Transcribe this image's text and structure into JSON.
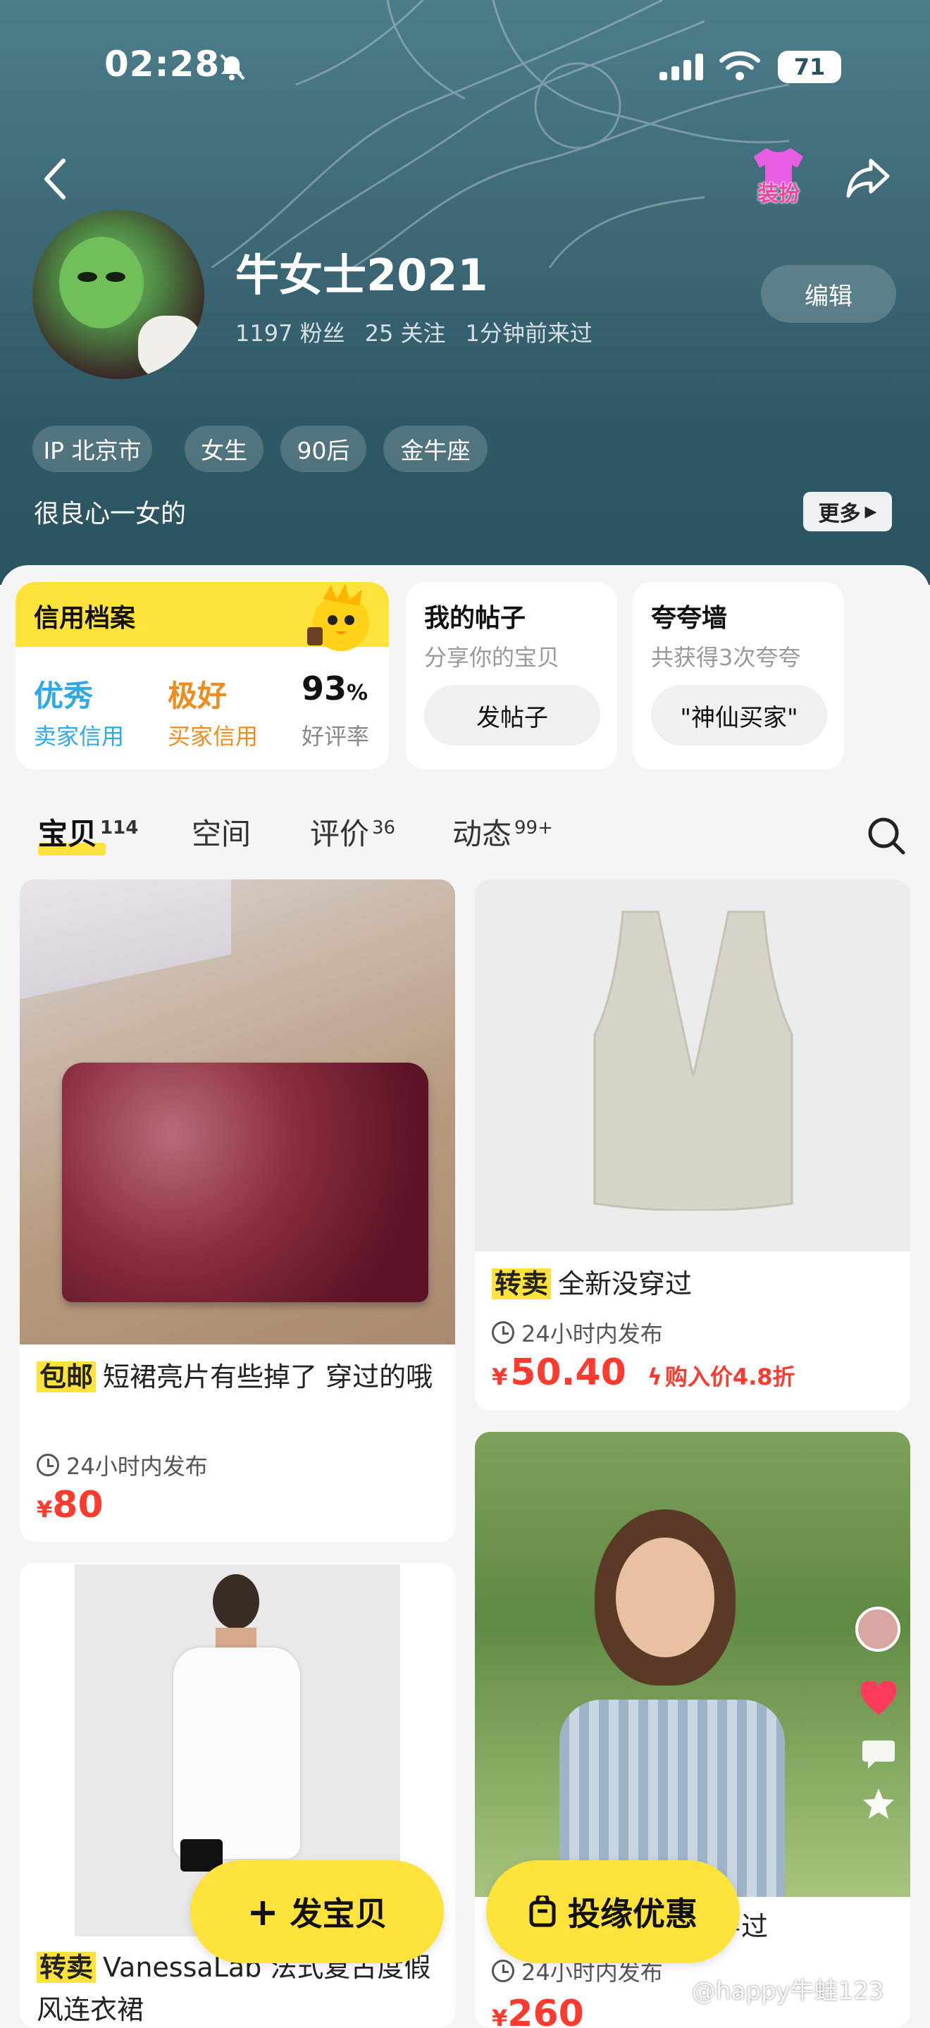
{
  "status_bar": {
    "time": "02:28",
    "battery": "71"
  },
  "profile": {
    "name": "牛女士2021",
    "stats": {
      "fans": "1197 粉丝",
      "following": "25 关注",
      "last_seen": "1分钟前来过"
    },
    "edit_label": "编辑",
    "dress_up_label": "装扮",
    "tags": [
      "IP 北京市",
      "女生",
      "90后",
      "金牛座"
    ],
    "bio": "很良心一女的",
    "more_label": "更多"
  },
  "credit": {
    "title": "信用档案",
    "seller": {
      "value": "优秀",
      "label": "卖家信用"
    },
    "buyer": {
      "value": "极好",
      "label": "买家信用"
    },
    "rating": {
      "value": "93",
      "unit": "%",
      "label": "好评率"
    }
  },
  "posts": {
    "title": "我的帖子",
    "subtitle": "分享你的宝贝",
    "button": "发帖子"
  },
  "praise": {
    "title": "夸夸墙",
    "subtitle": "共获得3次夸夸",
    "button": "\"神仙买家\""
  },
  "tabs": [
    {
      "label": "宝贝",
      "count": "114"
    },
    {
      "label": "空间",
      "count": ""
    },
    {
      "label": "评价",
      "count": "36"
    },
    {
      "label": "动态",
      "count": "99+"
    }
  ],
  "products": [
    {
      "badge": "包邮",
      "title": "短裙亮片有些掉了 穿过的哦",
      "time": "24小时内发布",
      "currency": "¥",
      "price": "80"
    },
    {
      "badge": "转卖",
      "title": "全新没穿过",
      "time": "24小时内发布",
      "currency": "¥",
      "price": "50.40",
      "discount": "购入价4.8折"
    },
    {
      "badge": "转卖",
      "title": "VanessaLab 法式复古度假风连衣裙",
      "time": "",
      "currency": "",
      "price": ""
    },
    {
      "badge": "",
      "title": "穿过",
      "time": "24小时内发布",
      "currency": "¥",
      "price": "260"
    }
  ],
  "fab": {
    "publish": "发宝贝",
    "offer": "投缘优惠"
  },
  "watermark": "@happy牛蛙123",
  "colors": {
    "accent_yellow": "#ffe33a",
    "price_red": "#ff3b30",
    "seller_blue": "#2ea8e6",
    "buyer_orange": "#f08c1c"
  }
}
